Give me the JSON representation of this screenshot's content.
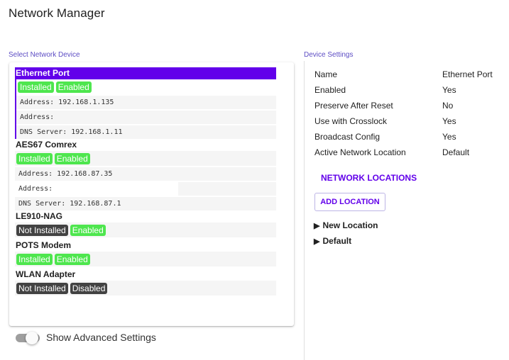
{
  "app": {
    "title": "Network Manager"
  },
  "labels": {
    "select_device": "Select Network Device",
    "device_settings": "Device Settings",
    "show_advanced": "Show Advanced Settings",
    "network_locations": "NETWORK LOCATIONS",
    "add_location": "ADD LOCATION"
  },
  "devices": [
    {
      "name": "Ethernet Port",
      "selected": true,
      "installed": "Installed",
      "enabled": "Enabled",
      "address1": "Address: 192.168.1.135",
      "address2": "Address:",
      "dns": "DNS Server: 192.168.1.11"
    },
    {
      "name": "AES67 Comrex",
      "selected": false,
      "installed": "Installed",
      "enabled": "Enabled",
      "address1": "Address: 192.168.87.35",
      "address2": "Address:",
      "dns": "DNS Server: 192.168.87.1"
    },
    {
      "name": "LE910-NAG",
      "selected": false,
      "installed": "Not Installed",
      "enabled": "Enabled"
    },
    {
      "name": "POTS Modem",
      "selected": false,
      "installed": "Installed",
      "enabled": "Enabled"
    },
    {
      "name": "WLAN Adapter",
      "selected": false,
      "installed": "Not Installed",
      "enabled": "Disabled"
    }
  ],
  "settings": [
    {
      "key": "Name",
      "value": "Ethernet Port"
    },
    {
      "key": "Enabled",
      "value": "Yes"
    },
    {
      "key": "Preserve After Reset",
      "value": "No"
    },
    {
      "key": "Use with Crosslock",
      "value": "Yes"
    },
    {
      "key": "Broadcast Config",
      "value": "Yes"
    },
    {
      "key": "Active Network Location",
      "value": "Default"
    }
  ],
  "locations": [
    {
      "label": "New Location"
    },
    {
      "label": "Default"
    }
  ],
  "colors": {
    "accent": "#6200ea",
    "badge_green": "#4ee64e",
    "badge_dark": "#424242",
    "label": "#5c4cc4"
  },
  "icons": {
    "expand": "triangle-right-icon",
    "toggle": "toggle-switch-icon"
  }
}
